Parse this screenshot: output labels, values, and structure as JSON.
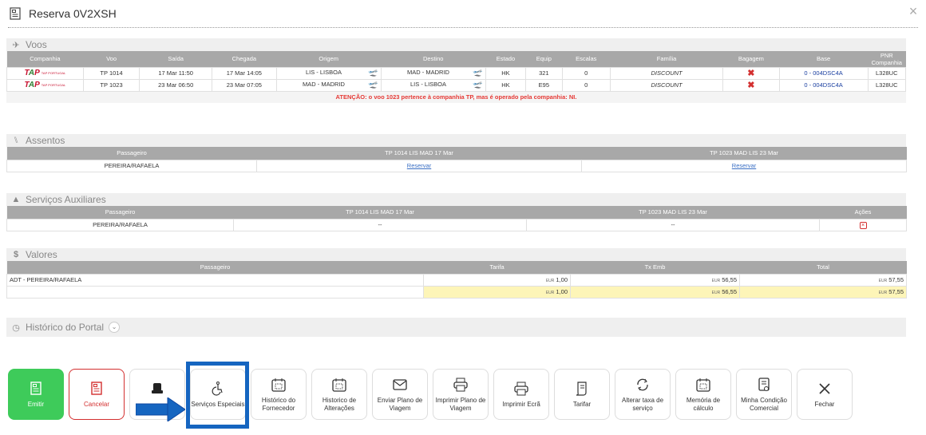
{
  "header": {
    "title": "Reserva 0V2XSH"
  },
  "voos": {
    "section_title": "Voos",
    "columns": [
      "Companhia",
      "Voo",
      "Saída",
      "Chegada",
      "Origem",
      "Destino",
      "Estado",
      "Equip",
      "Escalas",
      "Família",
      "Bagagem",
      "Base",
      "PNR Companhia"
    ],
    "rows": [
      {
        "voo": "TP 1014",
        "saida": "17 Mar 11:50",
        "chegada": "17 Mar 14:05",
        "origem": "LIS - LISBOA",
        "destino": "MAD - MADRID",
        "estado": "HK",
        "equip": "321",
        "escalas": "0",
        "familia": "DISCOUNT",
        "base": "0 - 004DSC4A",
        "pnr": "L328UC"
      },
      {
        "voo": "TP 1023",
        "saida": "23 Mar 06:50",
        "chegada": "23 Mar 07:05",
        "origem": "MAD - MADRID",
        "destino": "LIS - LISBOA",
        "estado": "HK",
        "equip": "E95",
        "escalas": "0",
        "familia": "DISCOUNT",
        "base": "0 - 004DSC4A",
        "pnr": "L328UC"
      }
    ],
    "logo_text": "TAP PORTUGAL",
    "warning": "ATENÇÃO: o voo 1023 pertence à companhia TP, mas é operado pela companhia: NI."
  },
  "assentos": {
    "section_title": "Assentos",
    "columns": [
      "Passageiro",
      "TP 1014 LIS MAD 17 Mar",
      "TP 1023 MAD LIS 23 Mar"
    ],
    "row": {
      "passageiro": "PEREIRA/RAFAELA",
      "reservar1": "Reservar",
      "reservar2": "Reservar"
    }
  },
  "servicos": {
    "section_title": "Serviços Auxiliares",
    "columns": [
      "Passageiro",
      "TP 1014 LIS MAD 17 Mar",
      "TP 1023 MAD LIS 23 Mar",
      "Ações"
    ],
    "row": {
      "passageiro": "PEREIRA/RAFAELA",
      "s1": "--",
      "s2": "--"
    }
  },
  "valores": {
    "section_title": "Valores",
    "columns": [
      "Passageiro",
      "Tarifa",
      "Tx Emb",
      "Total"
    ],
    "row": {
      "passageiro": "ADT - PEREIRA/RAFAELA",
      "tarifa": "1,00",
      "txemb": "56,55",
      "total": "57,55"
    },
    "totals": {
      "tarifa": "1,00",
      "txemb": "56,55",
      "total": "57,55"
    },
    "currency": "EUR"
  },
  "historico": {
    "section_title": "Histórico do Portal"
  },
  "toolbar": {
    "emitir": "Emitir",
    "cancelar": "Cancelar",
    "servicos_especiais": "Serviços Especiais",
    "historico_fornecedor": "Histórico do Fornecedor",
    "historico_alteracoes": "Historico de Alterações",
    "enviar_plano": "Enviar Plano de Viagem",
    "imprimir_plano": "Imprimir Plano de Viagem",
    "imprimir_ecra": "Imprimir Ecrã",
    "tarifar": "Tarifar",
    "alterar_taxa": "Alterar taxa de serviço",
    "memoria_calculo": "Memória de cálculo",
    "minha_condicao": "Minha Condição Comercial",
    "fechar": "Fechar"
  },
  "colors": {
    "highlight": "#1565c0",
    "emitir": "#3ecb5a",
    "cancel": "#d32f2f",
    "table_header": "#a8a8a8",
    "total_row": "#fdf5b8"
  }
}
